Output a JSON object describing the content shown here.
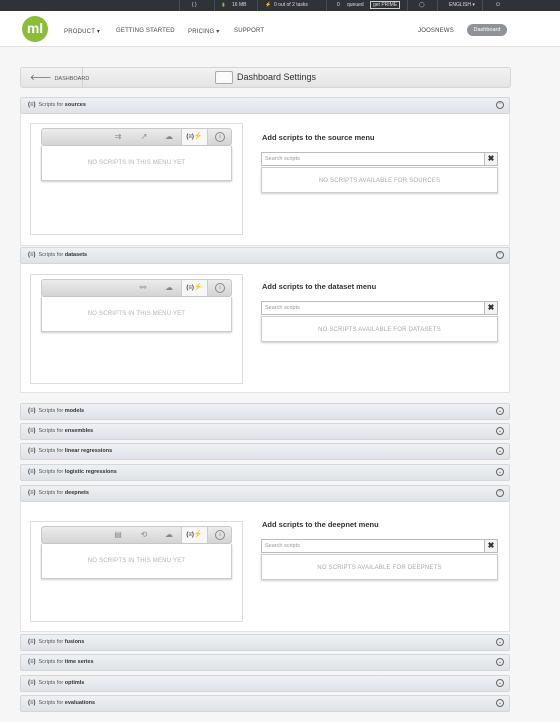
{
  "topbar": {
    "code_icon": "{ }",
    "storage": "16 MB",
    "tasks": "0 out of 2 tasks",
    "queued_count": "0",
    "queued_label": "queued",
    "prime": "get PRIME",
    "language": "ENGLISH ▾"
  },
  "header": {
    "logo": "ml",
    "nav": [
      "PRODUCT ▾",
      "GETTING STARTED",
      "PRICING ▾",
      "SUPPORT"
    ],
    "user": "JOOSNEWS",
    "dashboard": "Dashboard"
  },
  "titlebar": {
    "back": "DASHBOARD",
    "title": "Dashboard Settings"
  },
  "common": {
    "prefix": "Scripts for",
    "script_icon": "(≡)",
    "empty_menu": "NO SCRIPTS IN THIS MENU YET",
    "search_placeholder": "Search scripts",
    "clear": "✖",
    "info": "i"
  },
  "sections": [
    {
      "name": "sources",
      "expanded": true,
      "add_title": "Add scripts to the source menu",
      "none_text": "NO SCRIPTS AVAILABLE FOR SOURCES"
    },
    {
      "name": "datasets",
      "expanded": true,
      "add_title": "Add scripts to the dataset menu",
      "none_text": "NO SCRIPTS AVAILABLE FOR DATASETS"
    },
    {
      "name": "models",
      "expanded": false
    },
    {
      "name": "ensembles",
      "expanded": false
    },
    {
      "name": "linear regressions",
      "expanded": false
    },
    {
      "name": "logistic regressions",
      "expanded": false
    },
    {
      "name": "deepnets",
      "expanded": true,
      "add_title": "Add scripts to the deepnet menu",
      "none_text": "NO SCRIPTS AVAILABLE FOR DEEPNETS"
    },
    {
      "name": "fusions",
      "expanded": false
    },
    {
      "name": "time series",
      "expanded": false
    },
    {
      "name": "optimls",
      "expanded": false
    },
    {
      "name": "evaluations",
      "expanded": false
    }
  ],
  "colors": {
    "brand": "#8bbd3a",
    "topbar": "#2f3237"
  }
}
